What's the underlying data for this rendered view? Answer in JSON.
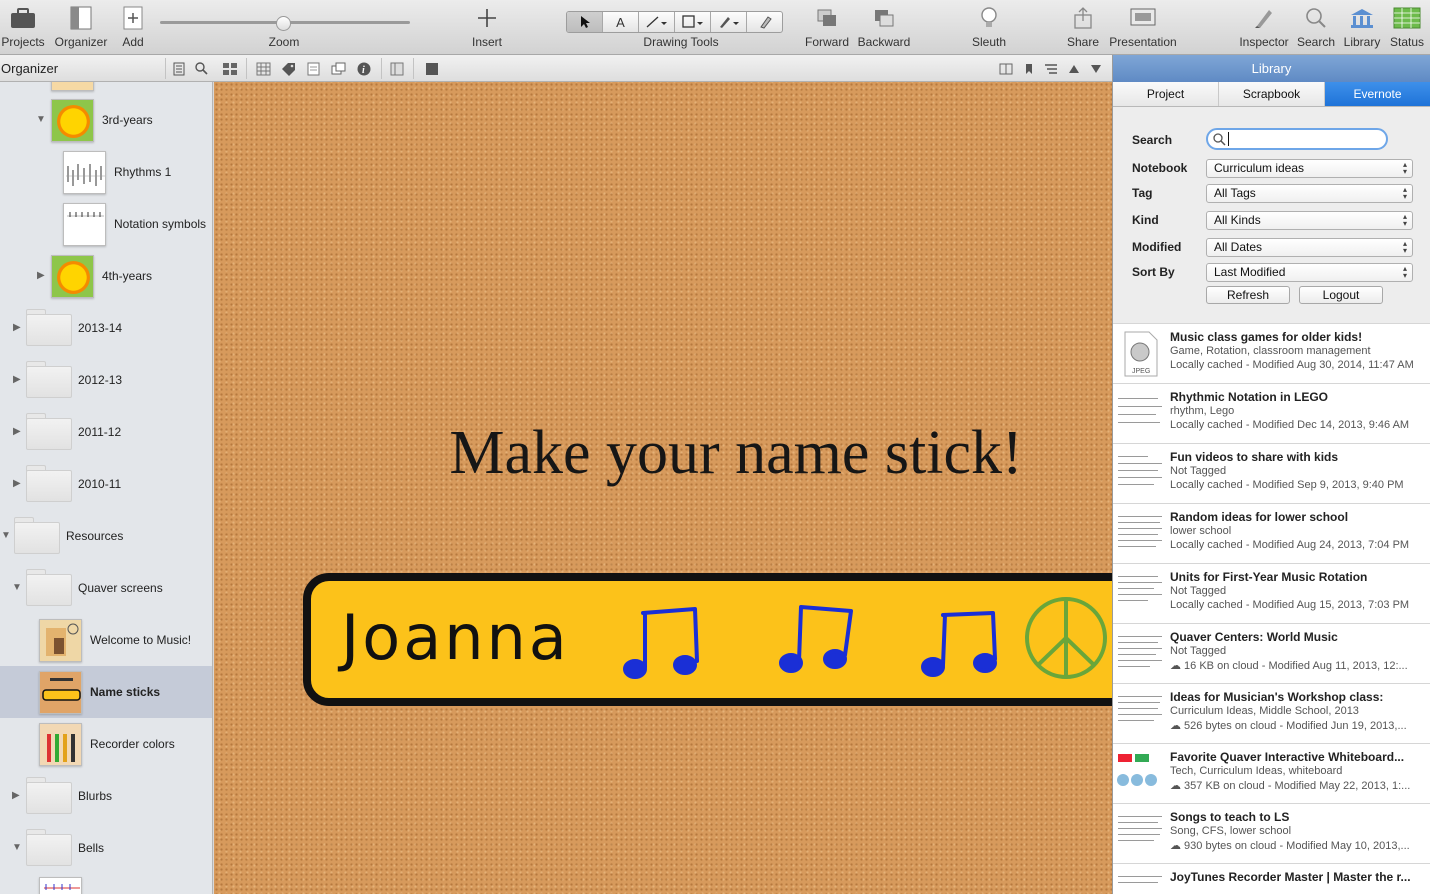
{
  "toolbar": {
    "projects": "Projects",
    "organizer": "Organizer",
    "add": "Add",
    "zoom": "Zoom",
    "insert": "Insert",
    "drawing_tools": "Drawing Tools",
    "forward": "Forward",
    "backward": "Backward",
    "sleuth": "Sleuth",
    "share": "Share",
    "presentation": "Presentation",
    "inspector": "Inspector",
    "search": "Search",
    "library": "Library",
    "status": "Status"
  },
  "organizer": {
    "title": "Organizer",
    "items": [
      {
        "label": "3rd-years"
      },
      {
        "label": "Rhythms 1"
      },
      {
        "label": "Notation symbols"
      },
      {
        "label": "4th-years"
      },
      {
        "label": "2013-14"
      },
      {
        "label": "2012-13"
      },
      {
        "label": "2011-12"
      },
      {
        "label": "2010-11"
      },
      {
        "label": "Resources"
      },
      {
        "label": "Quaver screens"
      },
      {
        "label": "Welcome to Music!"
      },
      {
        "label": "Name sticks"
      },
      {
        "label": "Recorder colors"
      },
      {
        "label": "Blurbs"
      },
      {
        "label": "Bells"
      }
    ]
  },
  "canvas": {
    "title": "Make your name stick!",
    "stick_name": "Joanna"
  },
  "library": {
    "title": "Library",
    "tabs": [
      "Project",
      "Scrapbook",
      "Evernote"
    ],
    "active_tab": "Evernote",
    "search_label": "Search",
    "notebook_label": "Notebook",
    "notebook_value": "Curriculum ideas",
    "tag_label": "Tag",
    "tag_value": "All Tags",
    "kind_label": "Kind",
    "kind_value": "All Kinds",
    "modified_label": "Modified",
    "modified_value": "All Dates",
    "sortby_label": "Sort By",
    "sortby_value": "Last Modified",
    "refresh": "Refresh",
    "logout": "Logout",
    "notes": [
      {
        "title": "Music class games for older kids!",
        "tags": "Game, Rotation, classroom management",
        "meta": "Locally cached - Modified Aug 30, 2014, 11:47 AM"
      },
      {
        "title": "Rhythmic Notation in LEGO",
        "tags": "rhythm, Lego",
        "meta": "Locally cached - Modified Dec 14, 2013, 9:46 AM"
      },
      {
        "title": "Fun videos to share with kids",
        "tags": "Not Tagged",
        "meta": "Locally cached - Modified Sep 9, 2013, 9:40 PM"
      },
      {
        "title": "Random ideas for lower school",
        "tags": "lower school",
        "meta": "Locally cached - Modified Aug 24, 2013, 7:04 PM"
      },
      {
        "title": "Units for First-Year Music Rotation",
        "tags": "Not Tagged",
        "meta": "Locally cached - Modified Aug 15, 2013, 7:03 PM"
      },
      {
        "title": "Quaver Centers: World Music",
        "tags": "Not Tagged",
        "meta": "☁ 16 KB on cloud - Modified Aug 11, 2013, 12:..."
      },
      {
        "title": "Ideas for Musician's Workshop class:",
        "tags": "Curriculum Ideas, Middle School, 2013",
        "meta": "☁ 526 bytes on cloud - Modified Jun 19, 2013,..."
      },
      {
        "title": "Favorite Quaver Interactive Whiteboard...",
        "tags": "Tech, Curriculum Ideas, whiteboard",
        "meta": "☁ 357 KB on cloud - Modified May 22, 2013, 1:..."
      },
      {
        "title": "Songs to teach to LS",
        "tags": "Song, CFS, lower school",
        "meta": "☁ 930 bytes on cloud - Modified May 10, 2013,..."
      },
      {
        "title": "JoyTunes Recorder Master | Master the r...",
        "tags": "",
        "meta": ""
      }
    ],
    "first_thumb_label": "JPEG"
  },
  "colors": {
    "accent": "#1f73d8",
    "stick": "#fcc21a",
    "note_blue": "#1a2fd6",
    "peace": "#6aa63a"
  }
}
